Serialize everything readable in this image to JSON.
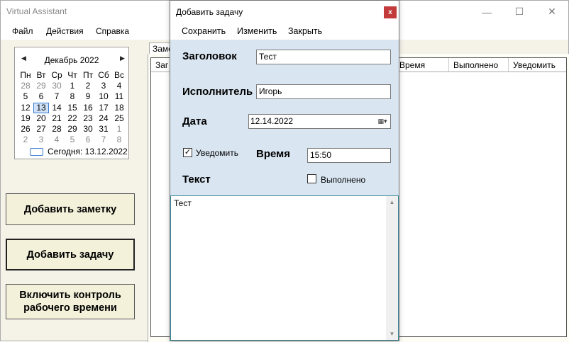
{
  "app": {
    "title": "Virtual Assistant",
    "controls": {
      "minimize": "—",
      "maximize": "☐",
      "close": "✕"
    }
  },
  "menu": {
    "file": "Файл",
    "actions": "Действия",
    "help": "Справка"
  },
  "calendar": {
    "prev": "◀",
    "next": "▶",
    "month": "Декабрь 2022",
    "days": [
      "Пн",
      "Вт",
      "Ср",
      "Чт",
      "Пт",
      "Сб",
      "Вс"
    ],
    "weeks": [
      [
        "28",
        "29",
        "30",
        "1",
        "2",
        "3",
        "4"
      ],
      [
        "5",
        "6",
        "7",
        "8",
        "9",
        "10",
        "11"
      ],
      [
        "12",
        "13",
        "14",
        "15",
        "16",
        "17",
        "18"
      ],
      [
        "19",
        "20",
        "21",
        "22",
        "23",
        "24",
        "25"
      ],
      [
        "26",
        "27",
        "28",
        "29",
        "30",
        "31",
        "1"
      ],
      [
        "2",
        "3",
        "4",
        "5",
        "6",
        "7",
        "8"
      ]
    ],
    "today_label": "Сегодня: 13.12.2022"
  },
  "buttons": {
    "add_note": "Добавить заметку",
    "add_task": "Добавить задачу",
    "worktime_line1": "Включить контроль",
    "worktime_line2": "рабочего времени"
  },
  "tabs": {
    "notes": "Заметки"
  },
  "grid": {
    "headers": [
      "Заг",
      "Время",
      "Выполнено",
      "Уведомить"
    ]
  },
  "dialog": {
    "title": "Добавить задачу",
    "close": "x",
    "menu": {
      "save": "Сохранить",
      "edit": "Изменить",
      "close": "Закрыть"
    },
    "title_label": "Заголовок",
    "title_value": "Тест",
    "assignee_label": "Исполнитель",
    "assignee_value": "Игорь",
    "date_label": "Дата",
    "date_value": "12.14.2022",
    "notify_label": "Уведомить",
    "time_label": "Время",
    "time_value": "15:50",
    "text_label": "Текст",
    "done_label": "Выполнено",
    "text_value": "Тест"
  }
}
